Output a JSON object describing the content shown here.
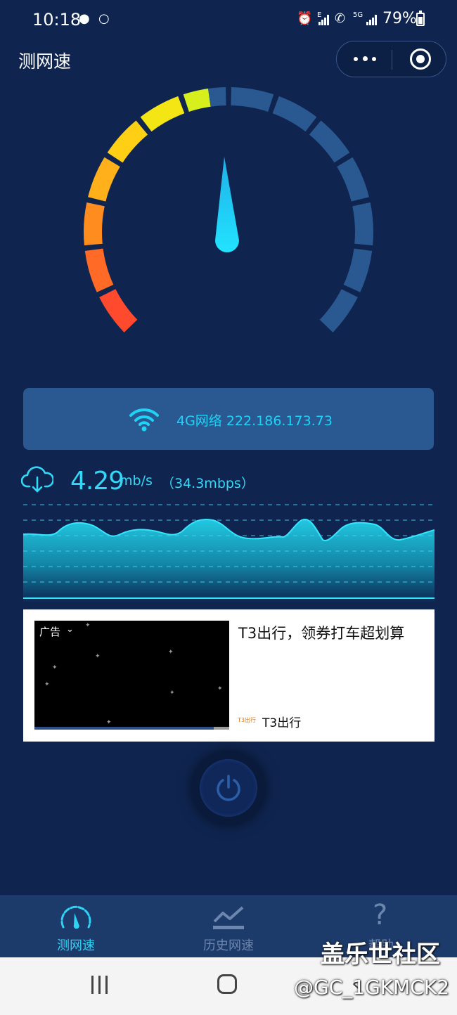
{
  "status_bar": {
    "time": "10:18",
    "battery": "79%",
    "net_label_1": "E",
    "net_label_2": "5G"
  },
  "title_bar": {
    "title": "测网速",
    "more_icon": "more-dots-icon",
    "close_icon": "target-close-icon"
  },
  "gauge": {
    "value_fraction": 0.47,
    "needle_color": "#1fd3f7",
    "inactive_color": "#2a5890"
  },
  "network": {
    "label": "4G网络 222.186.173.73",
    "icon": "wifi-icon"
  },
  "speed": {
    "value": "4.29",
    "unit": "mb/s",
    "mbps": "（34.3mbps）",
    "icon": "cloud-download-icon"
  },
  "ad": {
    "label": "广告",
    "headline": "T3出行，领券打车超划算",
    "brand_logo_text": "T3出行",
    "brand": "T3出行"
  },
  "tabs": [
    {
      "label": "测网速",
      "icon": "speedometer-icon",
      "active": true
    },
    {
      "label": "历史网速",
      "icon": "history-chart-icon",
      "active": false
    },
    {
      "label": "帮助",
      "icon": "question-icon",
      "active": false
    }
  ],
  "watermark": {
    "title": "盖乐世社区",
    "handle": "@GC_1GKMCK2"
  },
  "colors": {
    "background": "#0f2550",
    "accent": "#1fd3f7",
    "card": "#2a5890"
  }
}
